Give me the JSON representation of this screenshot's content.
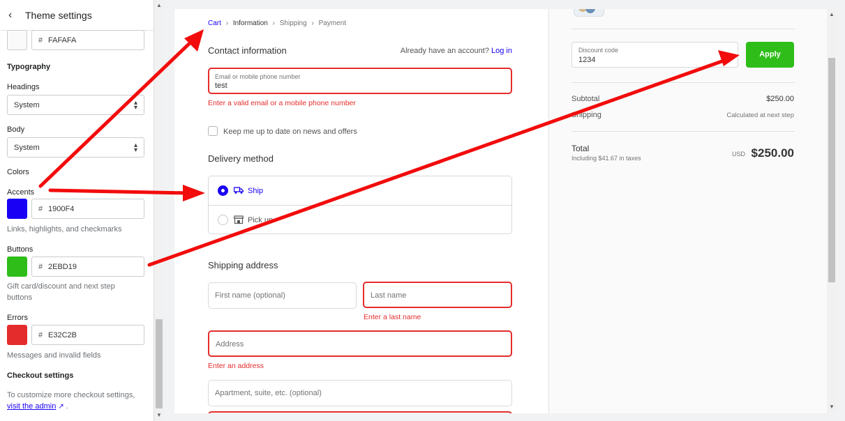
{
  "sidebar": {
    "title": "Theme settings",
    "background_hex": "FAFAFA",
    "typography_heading": "Typography",
    "headings_label": "Headings",
    "headings_value": "System",
    "body_label": "Body",
    "body_value": "System",
    "colors_heading": "Colors",
    "accents_label": "Accents",
    "accents_hex": "1900F4",
    "accents_help": "Links, highlights, and checkmarks",
    "buttons_label": "Buttons",
    "buttons_hex": "2EBD19",
    "buttons_help_1": "Gift card/discount and next step",
    "buttons_help_2": "buttons",
    "errors_label": "Errors",
    "errors_hex": "E32C2B",
    "errors_help": "Messages and invalid fields",
    "checkout_heading": "Checkout settings",
    "checkout_help": "To customize more checkout settings,",
    "admin_link": "visit the admin",
    "hash": "#",
    "colors": {
      "background": "#FAFAFA",
      "accent": "#1900F4",
      "button": "#2EBD19",
      "error": "#E32C2B"
    }
  },
  "checkout": {
    "breadcrumbs": [
      "Cart",
      "Information",
      "Shipping",
      "Payment"
    ],
    "contact_heading": "Contact information",
    "have_account": "Already have an account?",
    "login_link": "Log in",
    "email_label": "Email or mobile phone number",
    "email_value": "test",
    "email_error": "Enter a valid email or a mobile phone number",
    "newsletter_label": "Keep me up to date on news and offers",
    "delivery_heading": "Delivery method",
    "ship_label": "Ship",
    "pickup_label": "Pick up",
    "shipping_heading": "Shipping address",
    "first_name_ph": "First name (optional)",
    "last_name_ph": "Last name",
    "last_name_error": "Enter a last name",
    "address_ph": "Address",
    "address_error": "Enter an address",
    "apartment_ph": "Apartment, suite, etc. (optional)"
  },
  "summary": {
    "discount_label": "Discount code",
    "discount_value": "1234",
    "apply_label": "Apply",
    "subtotal_label": "Subtotal",
    "subtotal_value": "$250.00",
    "shipping_label": "Shipping",
    "shipping_value": "Calculated at next step",
    "total_label": "Total",
    "taxes_note": "Including $41.67 in taxes",
    "currency": "USD",
    "total_value": "$250.00"
  }
}
